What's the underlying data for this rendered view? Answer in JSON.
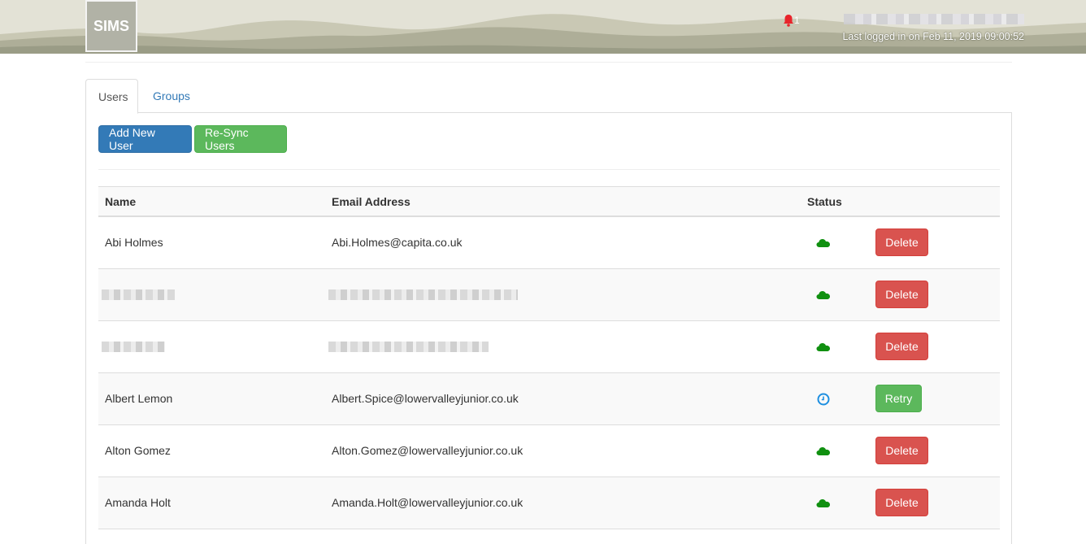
{
  "header": {
    "logo_text": "SIMS",
    "notification_count": "1",
    "user_name_redacted": true,
    "last_logged_in": "Last logged in on Feb 11, 2019 09:00:52",
    "colors": {
      "bell": "#e8242b",
      "banner": "#e3e2d6"
    }
  },
  "tabs": [
    {
      "label": "Users",
      "active": true
    },
    {
      "label": "Groups",
      "active": false
    }
  ],
  "toolbar": {
    "add_user_label": "Add New User",
    "resync_label": "Re-Sync Users"
  },
  "table": {
    "columns": {
      "name": "Name",
      "email": "Email Address",
      "status": "Status"
    },
    "rows": [
      {
        "name": "Abi Holmes",
        "email": "Abi.Holmes@capita.co.uk",
        "status": "cloud-synced",
        "action": "Delete"
      },
      {
        "name": "",
        "email": "",
        "redacted": true,
        "status": "cloud-synced",
        "action": "Delete"
      },
      {
        "name": "",
        "email": "",
        "redacted": true,
        "status": "cloud-synced",
        "action": "Delete"
      },
      {
        "name": "Albert Lemon",
        "email": "Albert.Spice@lowervalleyjunior.co.uk",
        "status": "clock-pending",
        "action": "Retry"
      },
      {
        "name": "Alton Gomez",
        "email": "Alton.Gomez@lowervalleyjunior.co.uk",
        "status": "cloud-synced",
        "action": "Delete"
      },
      {
        "name": "Amanda Holt",
        "email": "Amanda.Holt@lowervalleyjunior.co.uk",
        "status": "cloud-synced",
        "action": "Delete"
      }
    ]
  },
  "colors": {
    "primary": "#337ab7",
    "success": "#5cb85c",
    "danger": "#d9534f",
    "cloud_icon": "#109010",
    "clock_icon": "#1e8fe0"
  }
}
